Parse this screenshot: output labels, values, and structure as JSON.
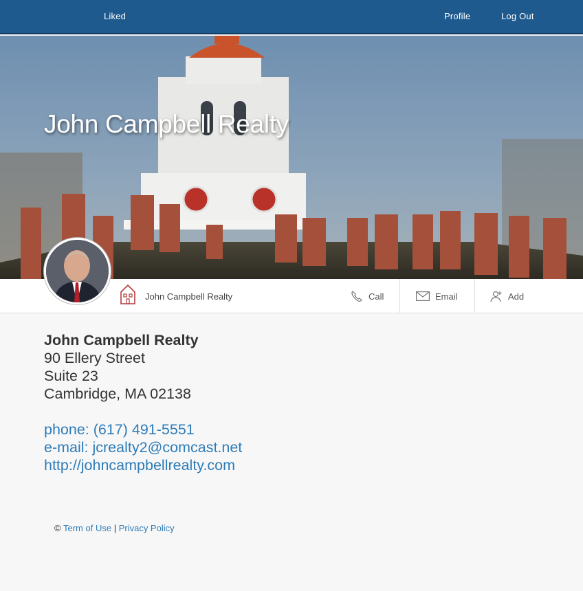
{
  "nav": {
    "liked": "Liked",
    "profile": "Profile",
    "logout": "Log Out"
  },
  "hero": {
    "title": "John Campbell Realty"
  },
  "profile_bar": {
    "name": "John Campbell Realty",
    "actions": {
      "call": "Call",
      "email": "Email",
      "add": "Add"
    }
  },
  "info": {
    "business_name": "John Campbell Realty",
    "address_line1": "90 Ellery Street",
    "address_line2": "Suite 23",
    "address_line3": "Cambridge, MA 02138",
    "phone": "phone: (617) 491-5551",
    "email": "e-mail:  jcrealty2@comcast.net",
    "website": "http://johncampbellrealty.com"
  },
  "footer": {
    "copyright": "©",
    "terms": "Term of Use",
    "separator": "|",
    "privacy": "Privacy Policy"
  },
  "colors": {
    "nav_bg": "#1e5a8e",
    "link": "#2e7cb8"
  }
}
